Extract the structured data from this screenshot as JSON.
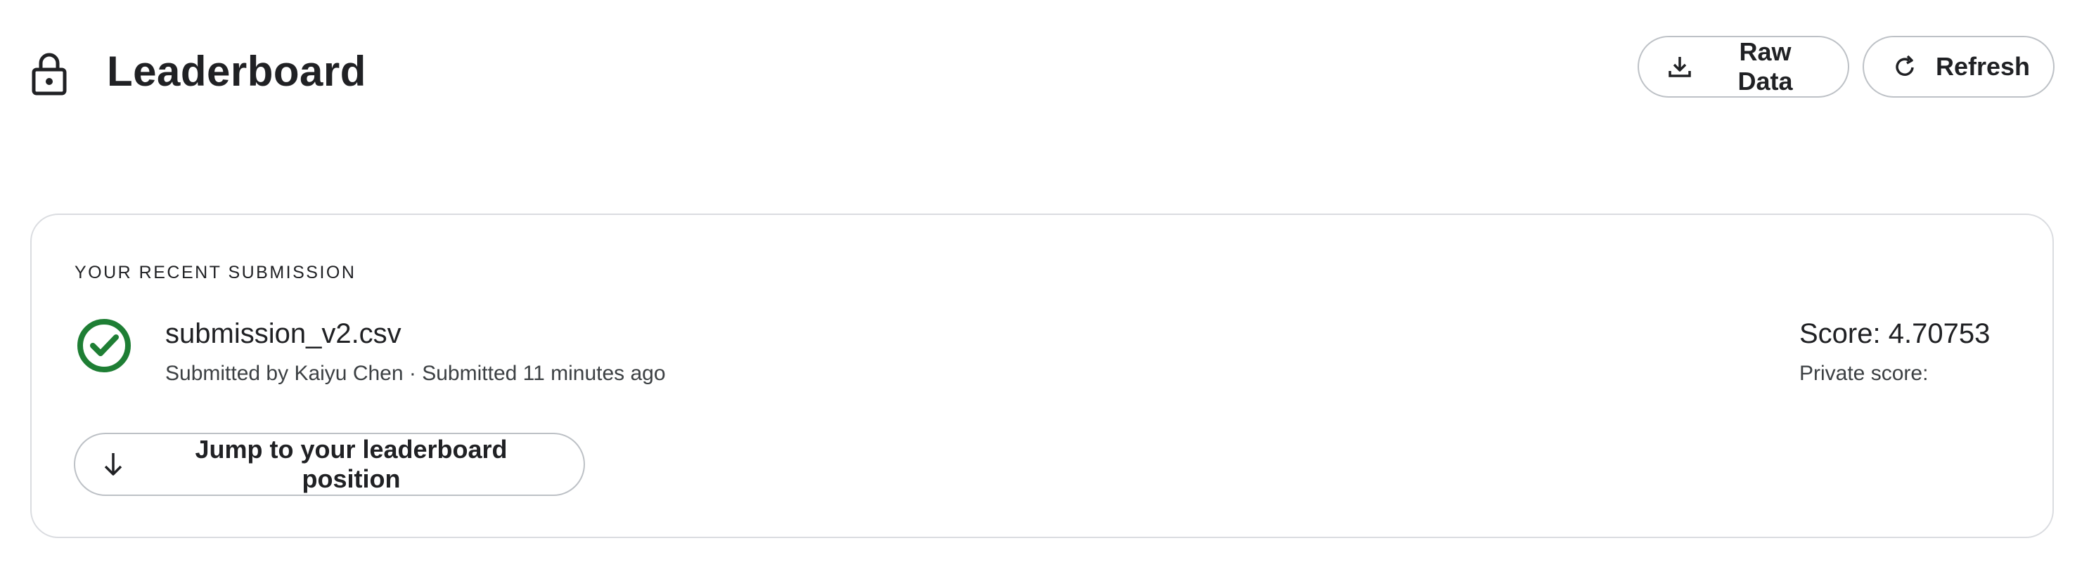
{
  "header": {
    "title": "Leaderboard",
    "lock_icon": "lock-icon",
    "buttons": {
      "raw_data": {
        "label": "Raw Data",
        "icon": "download-icon"
      },
      "refresh": {
        "label": "Refresh",
        "icon": "refresh-icon"
      }
    }
  },
  "submission": {
    "heading": "YOUR RECENT SUBMISSION",
    "status_icon": "check-circle-icon",
    "file_name": "submission_v2.csv",
    "submitted_by_label": "Submitted by",
    "submitter": "Kaiyu Chen",
    "separator": "·",
    "submitted_time": "Submitted 11 minutes ago",
    "score_label": "Score:",
    "score_value": "4.70753",
    "private_score_label": "Private score:",
    "private_score_value": "",
    "jump_button": {
      "label": "Jump to your leaderboard position",
      "icon": "arrow-down-icon"
    }
  },
  "colors": {
    "success": "#1e7e34",
    "text": "#202124",
    "muted": "#3c4043",
    "border": "#dadce0"
  }
}
